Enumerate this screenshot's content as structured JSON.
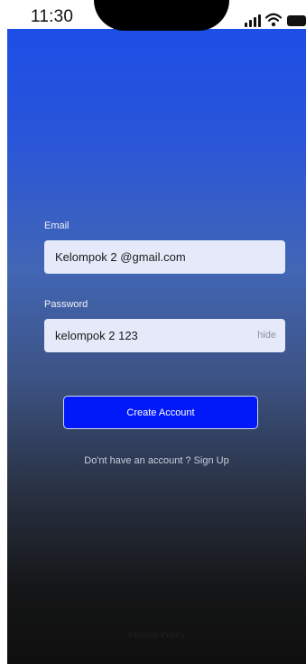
{
  "status_bar": {
    "time": "11:30"
  },
  "form": {
    "email": {
      "label": "Email",
      "value": "Kelompok 2 @gmail.com"
    },
    "password": {
      "label": "Password",
      "value": "kelompok 2 123",
      "toggle_label": "hide"
    },
    "submit_label": "Create Account",
    "signup_prompt": "Do'nt have an account ? Sign Up"
  },
  "footer": {
    "privacy_label": "Privacy Policy"
  },
  "colors": {
    "primary_button": "#0119f9",
    "gradient_top": "#1d4ee6",
    "gradient_bottom": "#0f0f0f",
    "input_background": "#e5e9f9"
  },
  "icons": {
    "signal": "signal-bars-icon",
    "wifi": "wifi-icon",
    "battery": "battery-icon"
  }
}
